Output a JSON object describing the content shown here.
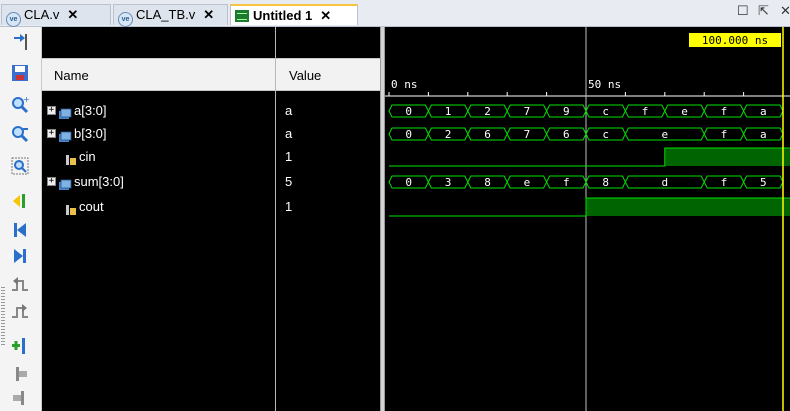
{
  "tabs": [
    {
      "label": "CLA.v",
      "close": "✕",
      "icon_text": "ve"
    },
    {
      "label": "CLA_TB.v",
      "close": "✕",
      "icon_text": "ve"
    },
    {
      "label": "Untitled 1",
      "close": "✕"
    }
  ],
  "window_controls": {
    "restore": "☐",
    "float": "⇱",
    "close": "✕"
  },
  "columns": {
    "name": "Name",
    "value": "Value"
  },
  "signals": [
    {
      "name": "a[3:0]",
      "value": "a",
      "type": "bus",
      "expander": "+"
    },
    {
      "name": "b[3:0]",
      "value": "a",
      "type": "bus",
      "expander": "+"
    },
    {
      "name": "cin",
      "value": "1",
      "type": "bit"
    },
    {
      "name": "sum[3:0]",
      "value": "5",
      "type": "bus",
      "expander": "+"
    },
    {
      "name": "cout",
      "value": "1",
      "type": "bit"
    }
  ],
  "waveform": {
    "cursor_time": "100.000 ns",
    "time_labels": [
      "0 ns",
      "50 ns"
    ],
    "visible_range_ns": [
      0,
      100
    ],
    "cursor_ns": 100,
    "marker_ns": 50,
    "bus_segments": {
      "a": [
        [
          "0",
          0,
          10
        ],
        [
          "1",
          10,
          20
        ],
        [
          "2",
          20,
          30
        ],
        [
          "7",
          30,
          40
        ],
        [
          "9",
          40,
          50
        ],
        [
          "c",
          50,
          60
        ],
        [
          "f",
          60,
          70
        ],
        [
          "e",
          70,
          80
        ],
        [
          "f",
          80,
          90
        ],
        [
          "a",
          90,
          100
        ]
      ],
      "b": [
        [
          "0",
          0,
          10
        ],
        [
          "2",
          10,
          20
        ],
        [
          "6",
          20,
          30
        ],
        [
          "7",
          30,
          40
        ],
        [
          "6",
          40,
          50
        ],
        [
          "c",
          50,
          60
        ],
        [
          "e",
          60,
          80
        ],
        [
          "f",
          80,
          90
        ],
        [
          "a",
          90,
          100
        ]
      ],
      "sum": [
        [
          "0",
          0,
          10
        ],
        [
          "3",
          10,
          20
        ],
        [
          "8",
          20,
          30
        ],
        [
          "e",
          30,
          40
        ],
        [
          "f",
          40,
          50
        ],
        [
          "8",
          50,
          60
        ],
        [
          "d",
          60,
          80
        ],
        [
          "f",
          80,
          90
        ],
        [
          "5",
          90,
          100
        ]
      ]
    },
    "bits": {
      "cin": [
        [
          0,
          0
        ],
        [
          70,
          1
        ]
      ],
      "cout": [
        [
          0,
          0
        ],
        [
          50,
          1
        ]
      ]
    },
    "colors": {
      "signal": "#00e000",
      "bit_high_fill": "#006400",
      "cursor": "#ffff00",
      "marker": "#c0c0c0",
      "background": "#000000",
      "text": "#ffffff"
    }
  },
  "toolbar_icons": [
    "pin-icon",
    "save-icon",
    "zoom-in-icon",
    "zoom-out-icon",
    "zoom-fit-icon",
    "cursor-to-zero-icon",
    "go-to-start-icon",
    "go-to-end-icon",
    "previous-transition-icon",
    "next-transition-icon",
    "add-marker-icon",
    "previous-marker-icon",
    "next-marker-icon"
  ]
}
